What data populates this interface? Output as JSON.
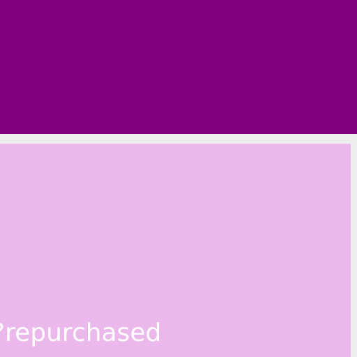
{
  "colors": {
    "header": "#800080",
    "card": "#ebb8ec",
    "background": "#eeeeee",
    "text": "#ffffff"
  },
  "card": {
    "label": "?repurchased"
  }
}
